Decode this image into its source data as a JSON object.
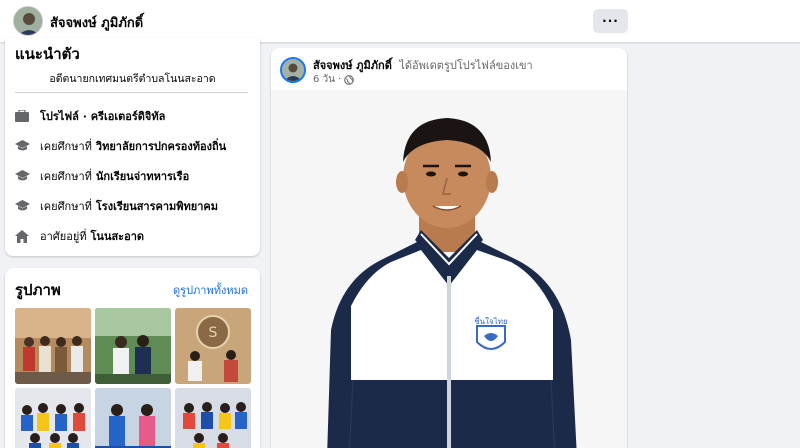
{
  "topbar": {
    "name": "สัจจพงษ์ ภูมิภักดิ์",
    "more_label": "···"
  },
  "intro": {
    "title": "แนะนำตัว",
    "bio": "อดีตนายกเทศมนตรีตำบลโนนสะอาด",
    "items": [
      {
        "icon": "briefcase-icon",
        "prefix": "โปรไฟล์ · ครีเอเตอร์ดิจิทัล",
        "value": ""
      },
      {
        "icon": "graduation-cap-icon",
        "prefix": "เคยศึกษาที่",
        "value": "วิทยาลัยการปกครองท้องถิ่น"
      },
      {
        "icon": "graduation-cap-icon",
        "prefix": "เคยศึกษาที่",
        "value": "นักเรียนจ่าทหารเรือ"
      },
      {
        "icon": "graduation-cap-icon",
        "prefix": "เคยศึกษาที่",
        "value": "โรงเรียนสารคามพิทยาคม"
      },
      {
        "icon": "home-icon",
        "prefix": "อาศัยอยู่ที่",
        "value": "โนนสะอาด"
      }
    ]
  },
  "photos": {
    "title": "รูปภาพ",
    "see_all": "ดูรูปภาพทั้งหมด"
  },
  "post": {
    "author": "สัจจพงษ์ ภูมิภักดิ์",
    "action": "ได้อัพเดตรูปโปรไฟล์ของเขา",
    "time": "6 วัน",
    "separator": "·",
    "jacket_logo_text": "ชื่นใจไทย"
  },
  "colors": {
    "link": "#216fdb",
    "accent_blue": "#1877f2",
    "jacket_navy": "#1c2a4a"
  }
}
